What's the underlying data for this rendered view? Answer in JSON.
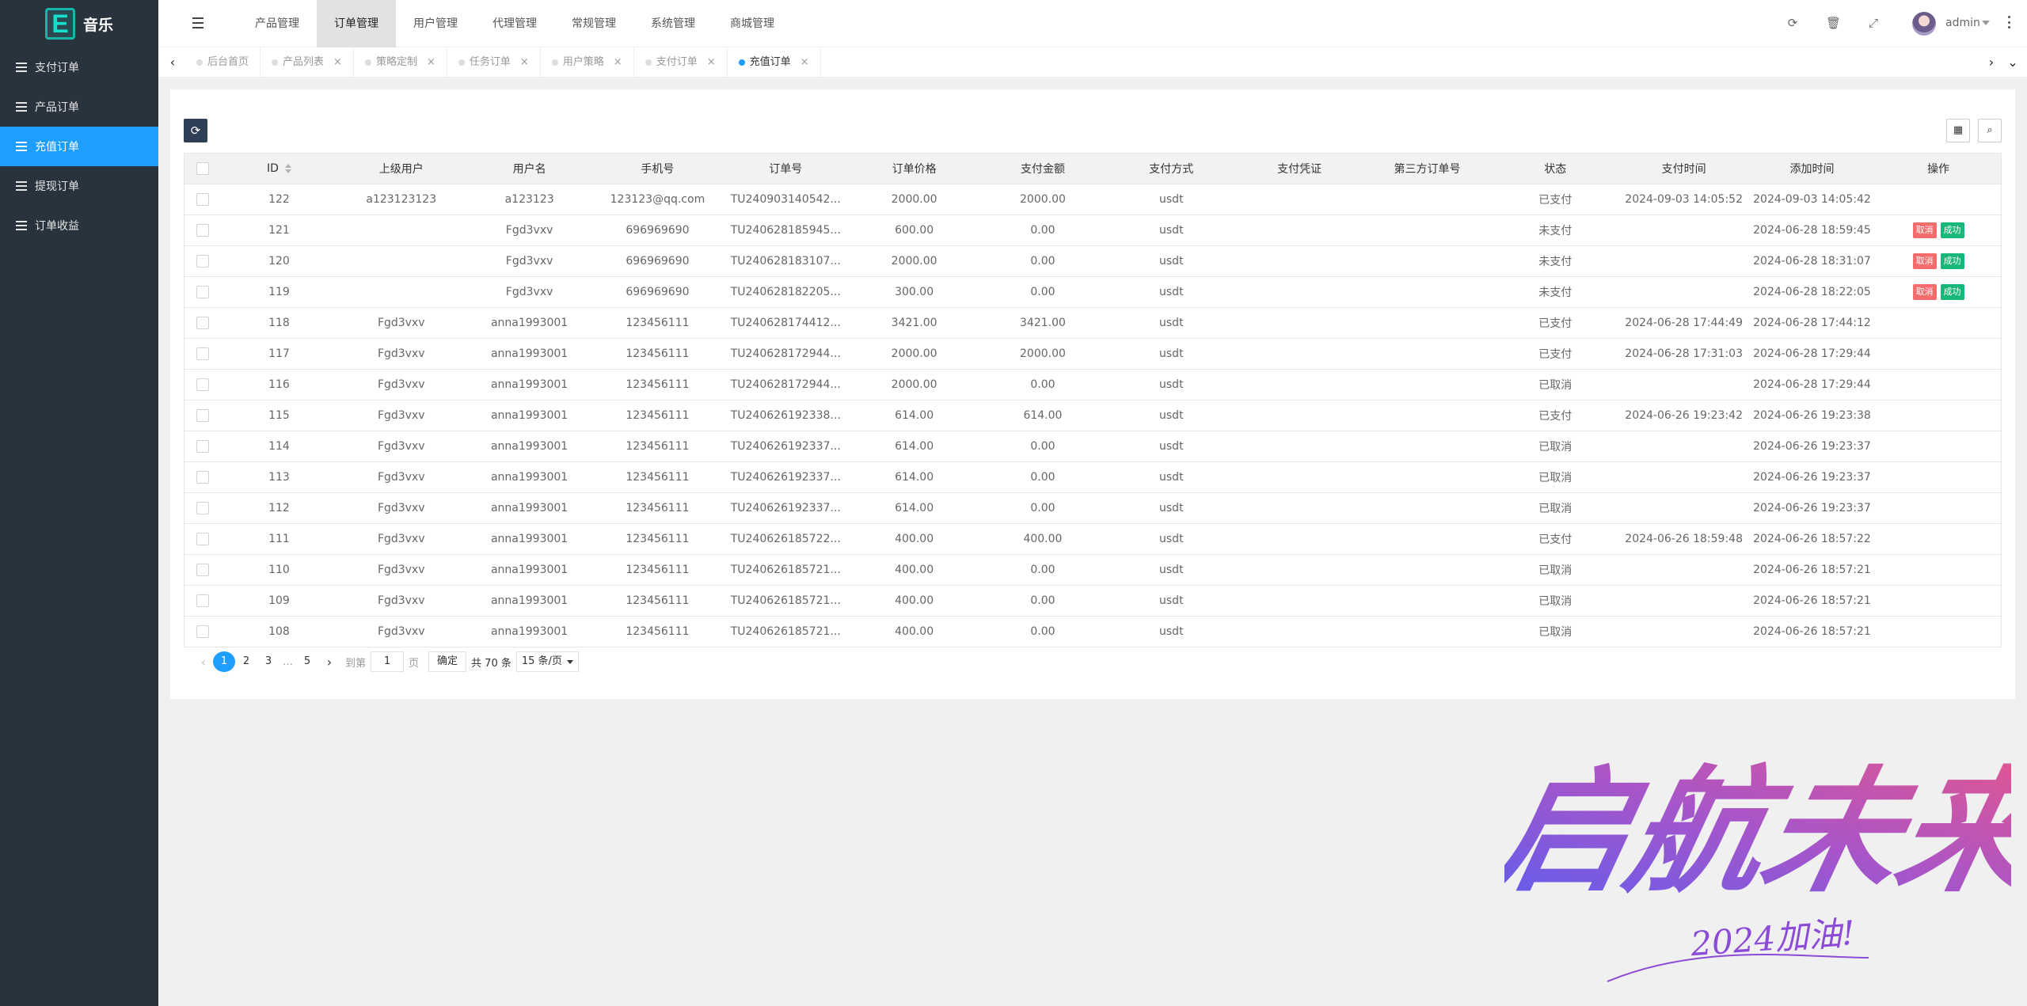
{
  "brand": {
    "logo_letter": "E",
    "name": "音乐"
  },
  "sidebar": {
    "items": [
      {
        "label": "支付订单",
        "active": false
      },
      {
        "label": "产品订单",
        "active": false
      },
      {
        "label": "充值订单",
        "active": true
      },
      {
        "label": "提现订单",
        "active": false
      },
      {
        "label": "订单收益",
        "active": false
      }
    ]
  },
  "top_nav": [
    {
      "label": "产品管理",
      "active": false
    },
    {
      "label": "订单管理",
      "active": true
    },
    {
      "label": "用户管理",
      "active": false
    },
    {
      "label": "代理管理",
      "active": false
    },
    {
      "label": "常规管理",
      "active": false
    },
    {
      "label": "系统管理",
      "active": false
    },
    {
      "label": "商城管理",
      "active": false
    }
  ],
  "header": {
    "user": "admin"
  },
  "tabs": [
    {
      "label": "后台首页",
      "closable": false,
      "active": false
    },
    {
      "label": "产品列表",
      "closable": true,
      "active": false
    },
    {
      "label": "策略定制",
      "closable": true,
      "active": false
    },
    {
      "label": "任务订单",
      "closable": true,
      "active": false
    },
    {
      "label": "用户策略",
      "closable": true,
      "active": false
    },
    {
      "label": "支付订单",
      "closable": true,
      "active": false
    },
    {
      "label": "充值订单",
      "closable": true,
      "active": true
    }
  ],
  "table": {
    "columns": [
      "ID",
      "上级用户",
      "用户名",
      "手机号",
      "订单号",
      "订单价格",
      "支付金额",
      "支付方式",
      "支付凭证",
      "第三方订单号",
      "状态",
      "支付时间",
      "添加时间",
      "操作"
    ],
    "actions": {
      "cancel": "取消",
      "success": "成功"
    },
    "rows": [
      [
        "122",
        "a123123123",
        "a123123",
        "123123@qq.com",
        "TU240903140542...",
        "2000.00",
        "2000.00",
        "usdt",
        "",
        "",
        "已支付",
        "2024-09-03 14:05:52",
        "2024-09-03 14:05:42",
        false
      ],
      [
        "121",
        "",
        "Fgd3vxv",
        "696969690",
        "TU240628185945...",
        "600.00",
        "0.00",
        "usdt",
        "",
        "",
        "未支付",
        "",
        "2024-06-28 18:59:45",
        true
      ],
      [
        "120",
        "",
        "Fgd3vxv",
        "696969690",
        "TU240628183107...",
        "2000.00",
        "0.00",
        "usdt",
        "",
        "",
        "未支付",
        "",
        "2024-06-28 18:31:07",
        true
      ],
      [
        "119",
        "",
        "Fgd3vxv",
        "696969690",
        "TU240628182205...",
        "300.00",
        "0.00",
        "usdt",
        "",
        "",
        "未支付",
        "",
        "2024-06-28 18:22:05",
        true
      ],
      [
        "118",
        "Fgd3vxv",
        "anna1993001",
        "123456111",
        "TU240628174412...",
        "3421.00",
        "3421.00",
        "usdt",
        "",
        "",
        "已支付",
        "2024-06-28 17:44:49",
        "2024-06-28 17:44:12",
        false
      ],
      [
        "117",
        "Fgd3vxv",
        "anna1993001",
        "123456111",
        "TU240628172944...",
        "2000.00",
        "2000.00",
        "usdt",
        "",
        "",
        "已支付",
        "2024-06-28 17:31:03",
        "2024-06-28 17:29:44",
        false
      ],
      [
        "116",
        "Fgd3vxv",
        "anna1993001",
        "123456111",
        "TU240628172944...",
        "2000.00",
        "0.00",
        "usdt",
        "",
        "",
        "已取消",
        "",
        "2024-06-28 17:29:44",
        false
      ],
      [
        "115",
        "Fgd3vxv",
        "anna1993001",
        "123456111",
        "TU240626192338...",
        "614.00",
        "614.00",
        "usdt",
        "",
        "",
        "已支付",
        "2024-06-26 19:23:42",
        "2024-06-26 19:23:38",
        false
      ],
      [
        "114",
        "Fgd3vxv",
        "anna1993001",
        "123456111",
        "TU240626192337...",
        "614.00",
        "0.00",
        "usdt",
        "",
        "",
        "已取消",
        "",
        "2024-06-26 19:23:37",
        false
      ],
      [
        "113",
        "Fgd3vxv",
        "anna1993001",
        "123456111",
        "TU240626192337...",
        "614.00",
        "0.00",
        "usdt",
        "",
        "",
        "已取消",
        "",
        "2024-06-26 19:23:37",
        false
      ],
      [
        "112",
        "Fgd3vxv",
        "anna1993001",
        "123456111",
        "TU240626192337...",
        "614.00",
        "0.00",
        "usdt",
        "",
        "",
        "已取消",
        "",
        "2024-06-26 19:23:37",
        false
      ],
      [
        "111",
        "Fgd3vxv",
        "anna1993001",
        "123456111",
        "TU240626185722...",
        "400.00",
        "400.00",
        "usdt",
        "",
        "",
        "已支付",
        "2024-06-26 18:59:48",
        "2024-06-26 18:57:22",
        false
      ],
      [
        "110",
        "Fgd3vxv",
        "anna1993001",
        "123456111",
        "TU240626185721...",
        "400.00",
        "0.00",
        "usdt",
        "",
        "",
        "已取消",
        "",
        "2024-06-26 18:57:21",
        false
      ],
      [
        "109",
        "Fgd3vxv",
        "anna1993001",
        "123456111",
        "TU240626185721...",
        "400.00",
        "0.00",
        "usdt",
        "",
        "",
        "已取消",
        "",
        "2024-06-26 18:57:21",
        false
      ],
      [
        "108",
        "Fgd3vxv",
        "anna1993001",
        "123456111",
        "TU240626185721...",
        "400.00",
        "0.00",
        "usdt",
        "",
        "",
        "已取消",
        "",
        "2024-06-26 18:57:21",
        false
      ]
    ]
  },
  "pagination": {
    "pages": [
      "1",
      "2",
      "3"
    ],
    "ellipsis": "…",
    "last_page": "5",
    "goto_prefix": "到第",
    "goto_value": "1",
    "goto_suffix": "页",
    "confirm": "确定",
    "total": "共 70 条",
    "page_size": "15 条/页"
  },
  "watermark": {
    "main": "启航未来",
    "sub": "2024加油!"
  },
  "colors": {
    "sidebar_bg": "#28333e",
    "accent": "#1e9fff",
    "cancel": "#f56c6c",
    "success": "#16b777",
    "refresh_btn": "#2f4056"
  }
}
